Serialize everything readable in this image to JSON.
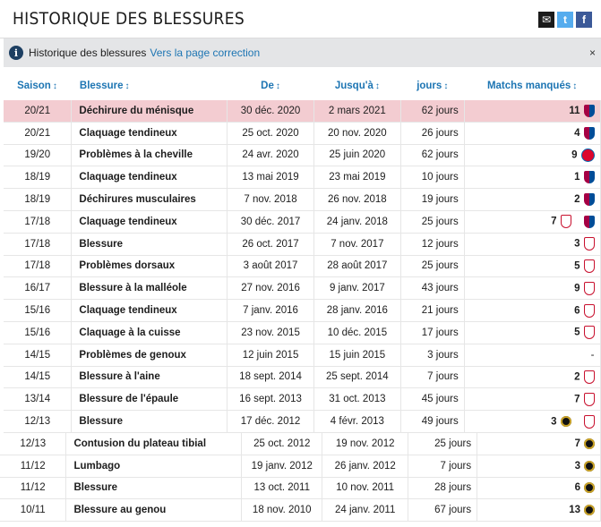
{
  "title": "HISTORIQUE DES BLESSURES",
  "info": {
    "text": "Historique des blessures",
    "link": "Vers la page correction",
    "close": "×"
  },
  "social": {
    "mail": "✉",
    "twitter": "t",
    "facebook": "f"
  },
  "headers": {
    "season": "Saison",
    "injury": "Blessure",
    "from": "De",
    "until": "Jusqu'à",
    "days": "jours",
    "missed": "Matchs manqués"
  },
  "rows": [
    {
      "season": "20/21",
      "injury": "Déchirure du ménisque",
      "from": "30 déc. 2020",
      "until": "2 mars 2021",
      "days": "62 jours",
      "missed": "11",
      "badges": [
        "barca"
      ]
    },
    {
      "season": "20/21",
      "injury": "Claquage tendineux",
      "from": "25 oct. 2020",
      "until": "20 nov. 2020",
      "days": "26 jours",
      "missed": "4",
      "badges": [
        "barca"
      ]
    },
    {
      "season": "19/20",
      "injury": "Problèmes à la cheville",
      "from": "24 avr. 2020",
      "until": "25 juin 2020",
      "days": "62 jours",
      "missed": "9",
      "badges": [
        "bayern"
      ]
    },
    {
      "season": "18/19",
      "injury": "Claquage tendineux",
      "from": "13 mai 2019",
      "until": "23 mai 2019",
      "days": "10 jours",
      "missed": "1",
      "badges": [
        "barca"
      ]
    },
    {
      "season": "18/19",
      "injury": "Déchirures musculaires",
      "from": "7 nov. 2018",
      "until": "26 nov. 2018",
      "days": "19 jours",
      "missed": "2",
      "badges": [
        "barca"
      ]
    },
    {
      "season": "17/18",
      "injury": "Claquage tendineux",
      "from": "30 déc. 2017",
      "until": "24 janv. 2018",
      "days": "25 jours",
      "missed": "7",
      "badges": [
        "liverpool",
        "barca"
      ]
    },
    {
      "season": "17/18",
      "injury": "Blessure",
      "from": "26 oct. 2017",
      "until": "7 nov. 2017",
      "days": "12 jours",
      "missed": "3",
      "badges": [
        "liverpool"
      ]
    },
    {
      "season": "17/18",
      "injury": "Problèmes dorsaux",
      "from": "3 août 2017",
      "until": "28 août 2017",
      "days": "25 jours",
      "missed": "5",
      "badges": [
        "liverpool"
      ]
    },
    {
      "season": "16/17",
      "injury": "Blessure à la malléole",
      "from": "27 nov. 2016",
      "until": "9 janv. 2017",
      "days": "43 jours",
      "missed": "9",
      "badges": [
        "liverpool"
      ]
    },
    {
      "season": "15/16",
      "injury": "Claquage tendineux",
      "from": "7 janv. 2016",
      "until": "28 janv. 2016",
      "days": "21 jours",
      "missed": "6",
      "badges": [
        "liverpool"
      ]
    },
    {
      "season": "15/16",
      "injury": "Claquage à la cuisse",
      "from": "23 nov. 2015",
      "until": "10 déc. 2015",
      "days": "17 jours",
      "missed": "5",
      "badges": [
        "liverpool"
      ]
    },
    {
      "season": "14/15",
      "injury": "Problèmes de genoux",
      "from": "12 juin 2015",
      "until": "15 juin 2015",
      "days": "3 jours",
      "missed": "-",
      "badges": []
    },
    {
      "season": "14/15",
      "injury": "Blessure à l'aine",
      "from": "18 sept. 2014",
      "until": "25 sept. 2014",
      "days": "7 jours",
      "missed": "2",
      "badges": [
        "liverpool"
      ]
    },
    {
      "season": "13/14",
      "injury": "Blessure de l'épaule",
      "from": "16 sept. 2013",
      "until": "31 oct. 2013",
      "days": "45 jours",
      "missed": "7",
      "badges": [
        "liverpool"
      ]
    },
    {
      "season": "12/13",
      "injury": "Blessure",
      "from": "17 déc. 2012",
      "until": "4 févr. 2013",
      "days": "49 jours",
      "missed": "3",
      "badges": [
        "inter",
        "liverpool"
      ]
    }
  ],
  "rows2": [
    {
      "season": "12/13",
      "injury": "Contusion du plateau tibial",
      "from": "25 oct. 2012",
      "until": "19 nov. 2012",
      "days": "25 jours",
      "missed": "7",
      "badges": [
        "inter"
      ]
    },
    {
      "season": "11/12",
      "injury": "Lumbago",
      "from": "19 janv. 2012",
      "until": "26 janv. 2012",
      "days": "7 jours",
      "missed": "3",
      "badges": [
        "inter"
      ]
    },
    {
      "season": "11/12",
      "injury": "Blessure",
      "from": "13 oct. 2011",
      "until": "10 nov. 2011",
      "days": "28 jours",
      "missed": "6",
      "badges": [
        "inter"
      ]
    },
    {
      "season": "10/11",
      "injury": "Blessure au genou",
      "from": "18 nov. 2010",
      "until": "24 janv. 2011",
      "days": "67 jours",
      "missed": "13",
      "badges": [
        "inter"
      ]
    }
  ]
}
